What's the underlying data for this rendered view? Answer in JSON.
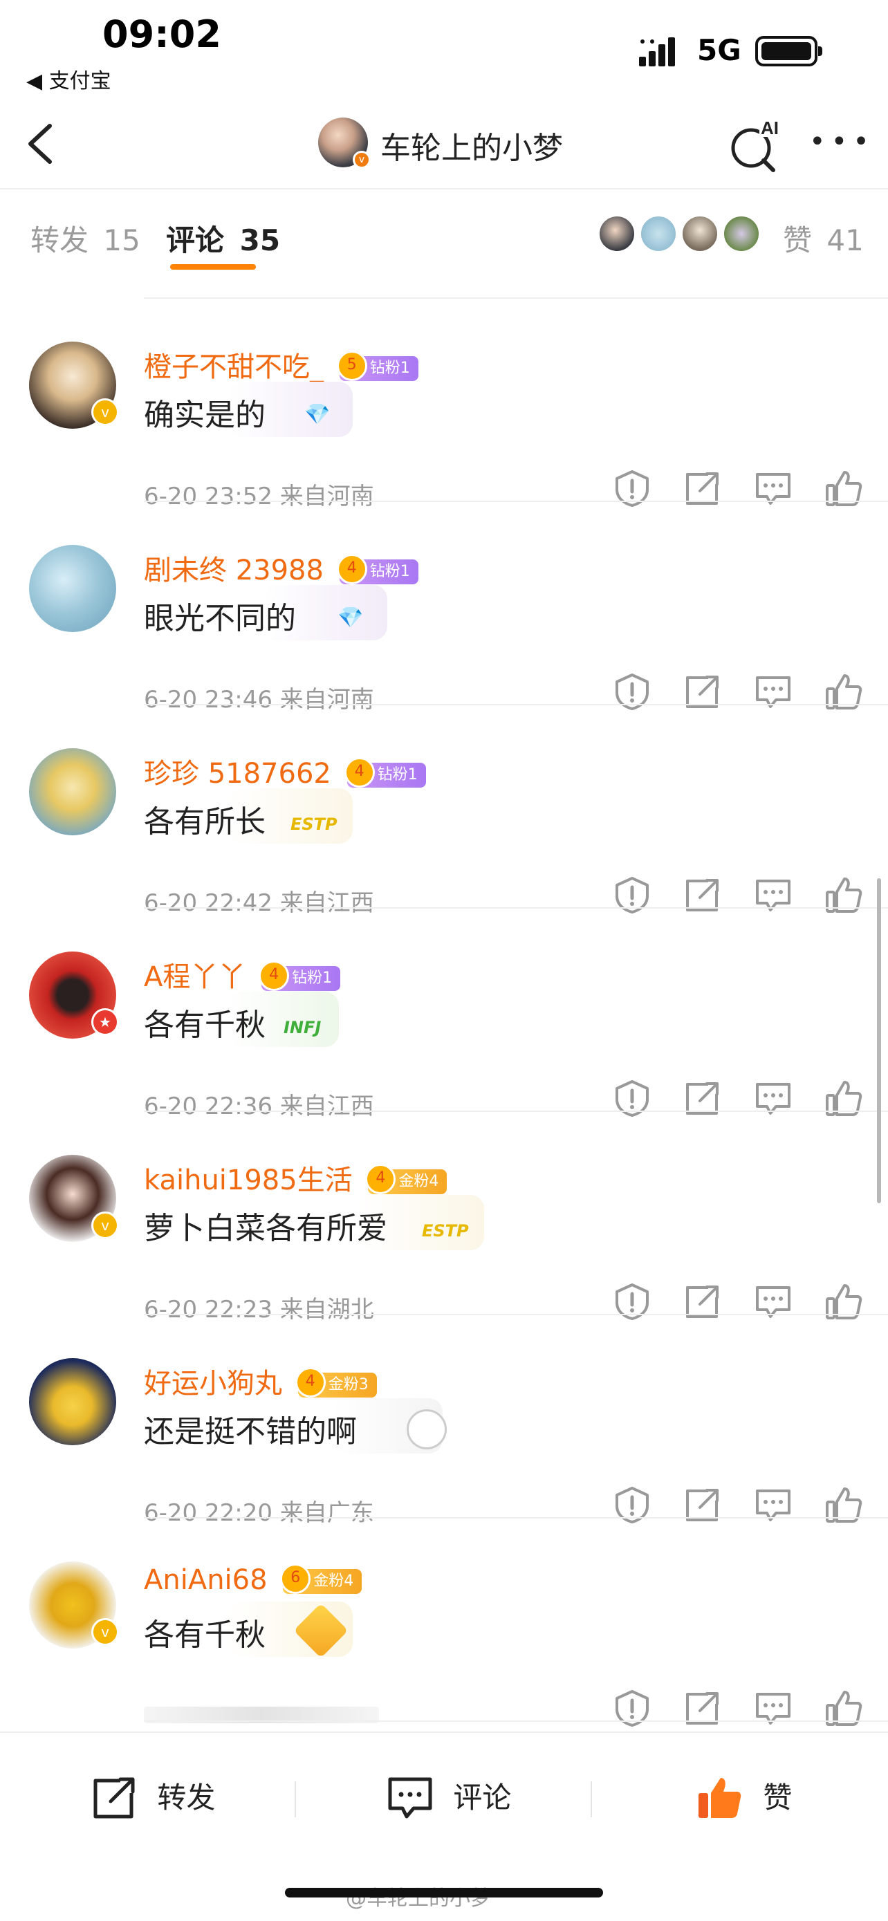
{
  "status_bar": {
    "time": "09:02",
    "back_app": "◀ 支付宝",
    "network": "5G"
  },
  "nav": {
    "title": "车轮上的小梦",
    "ai_label": "AI",
    "more_label": "•••"
  },
  "tabs": {
    "repost_label": "转发",
    "repost_count": "15",
    "comments_label": "评论",
    "comments_count": "35",
    "likes_label": "赞",
    "likes_count": "41"
  },
  "comments": [
    {
      "name": "橙子不甜不吃_",
      "badge_level": "5",
      "badge": "钻粉1",
      "badge_type": "diamond",
      "text": "确实是的",
      "date": "6-20 23:52",
      "location": "来自河南",
      "sticker": "💎"
    },
    {
      "name": "剧未终 23988",
      "badge_level": "4",
      "badge": "钻粉1",
      "badge_type": "diamond",
      "text": "眼光不同的",
      "date": "6-20 23:46",
      "location": "来自河南",
      "sticker": "💎"
    },
    {
      "name": "珍珍 5187662",
      "badge_level": "4",
      "badge": "钻粉1",
      "badge_type": "diamond",
      "text": "各有所长",
      "date": "6-20 22:42",
      "location": "来自江西",
      "sticker": "ESTP"
    },
    {
      "name": "A程丫丫",
      "badge_level": "4",
      "badge": "钻粉1",
      "badge_type": "diamond",
      "text": "各有千秋",
      "date": "6-20 22:36",
      "location": "来自江西",
      "sticker": "INFJ"
    },
    {
      "name": "kaihui1985生活",
      "badge_level": "4",
      "badge": "金粉4",
      "badge_type": "gold",
      "text": "萝卜白菜各有所爱",
      "date": "6-20 22:23",
      "location": "来自湖北",
      "sticker": "ESTP"
    },
    {
      "name": "好运小狗丸",
      "badge_level": "4",
      "badge": "金粉3",
      "badge_type": "gold",
      "text": "还是挺不错的啊",
      "date": "6-20 22:20",
      "location": "来自广东",
      "sticker": ""
    },
    {
      "name": "AniAni68",
      "badge_level": "6",
      "badge": "金粉4",
      "badge_type": "gold",
      "text": "各有千秋",
      "date": "",
      "location": "",
      "sticker": ""
    }
  ],
  "bottom_bar": {
    "repost": "转发",
    "comment": "评论",
    "like": "赞"
  },
  "watermark": "@车轮上的小梦",
  "colors": {
    "accent": "#ff8200",
    "username": "#f06a12",
    "meta": "#999999"
  }
}
